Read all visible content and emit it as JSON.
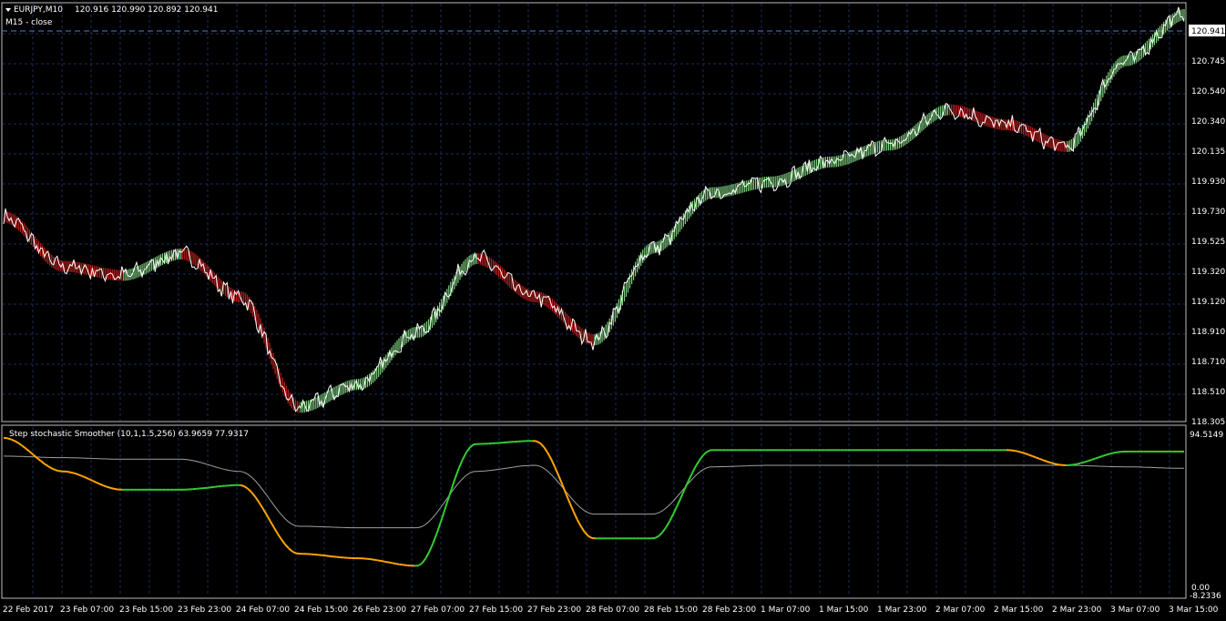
{
  "main_panel": {
    "symbol_label": "EURJPY,M10",
    "ohlc": "120.916 120.990 120.892 120.941",
    "overlay_label": "M15 - close",
    "current_price": "120.941",
    "price_ticks": [
      "120.745",
      "120.540",
      "120.340",
      "120.135",
      "119.930",
      "119.730",
      "119.525",
      "119.320",
      "119.120",
      "118.910",
      "118.710",
      "118.510",
      "118.305"
    ]
  },
  "indicator_panel": {
    "label": "Step stochastic Smoother (10,1,1.5,256) 63.9659 77.9317",
    "ticks": [
      "94.5149",
      "0.00",
      "-8.2336"
    ]
  },
  "time_axis": {
    "labels": [
      "22 Feb 2017",
      "23 Feb 07:00",
      "23 Feb 15:00",
      "23 Feb 23:00",
      "24 Feb 07:00",
      "24 Feb 15:00",
      "26 Feb 23:00",
      "27 Feb 07:00",
      "27 Feb 15:00",
      "27 Feb 23:00",
      "28 Feb 07:00",
      "28 Feb 15:00",
      "28 Feb 23:00",
      "1 Mar 07:00",
      "1 Mar 15:00",
      "1 Mar 23:00",
      "2 Mar 07:00",
      "2 Mar 15:00",
      "2 Mar 23:00",
      "3 Mar 07:00",
      "3 Mar 15:00"
    ]
  },
  "colors": {
    "background": "#000000",
    "grid": "#1c2c5a",
    "up": "#7fd17f",
    "down": "#c0201e",
    "close_line": "#ffffff",
    "stoch_up": "#32cd32",
    "stoch_down": "#ffa500",
    "signal": "#a0a0a0",
    "text": "#ffffff"
  },
  "chart_data": {
    "type": "line",
    "title": "EURJPY,M10",
    "y_range": [
      118.305,
      121.0
    ],
    "x": [
      "22 Feb 2017",
      "23 Feb 07:00",
      "23 Feb 15:00",
      "23 Feb 23:00",
      "24 Feb 07:00",
      "24 Feb 15:00",
      "26 Feb 23:00",
      "27 Feb 07:00",
      "27 Feb 15:00",
      "27 Feb 23:00",
      "28 Feb 07:00",
      "28 Feb 15:00",
      "28 Feb 23:00",
      "1 Mar 07:00",
      "1 Mar 15:00",
      "1 Mar 23:00",
      "2 Mar 07:00",
      "2 Mar 15:00",
      "2 Mar 23:00",
      "3 Mar 07:00",
      "3 Mar 15:00"
    ],
    "series": [
      {
        "name": "M15 - close",
        "values": [
          119.62,
          119.3,
          119.24,
          119.38,
          119.1,
          118.38,
          118.53,
          118.87,
          119.35,
          119.1,
          118.82,
          119.42,
          119.78,
          119.85,
          119.98,
          120.09,
          120.32,
          120.22,
          120.08,
          120.64,
          120.941
        ]
      }
    ],
    "indicator": {
      "title": "Step stochastic Smoother (10,1,1.5,256)",
      "y_range": [
        -8.2336,
        94.5149
      ],
      "series": [
        {
          "name": "Step stochastic Smoother",
          "values": [
            94.0,
            72.0,
            60.0,
            60.0,
            63.0,
            18.0,
            15.0,
            10.0,
            90.0,
            92.0,
            28.0,
            28.0,
            86.0,
            86.0,
            86.0,
            86.0,
            86.0,
            86.0,
            76.0,
            85.0,
            85.0
          ]
        },
        {
          "name": "63.9659 77.9317",
          "values": [
            82.0,
            81.0,
            80.0,
            80.0,
            72.0,
            36.0,
            35.0,
            35.0,
            72.0,
            76.0,
            44.0,
            44.0,
            75.0,
            76.0,
            76.0,
            76.0,
            76.0,
            76.0,
            76.0,
            75.0,
            74.0
          ]
        }
      ]
    }
  }
}
